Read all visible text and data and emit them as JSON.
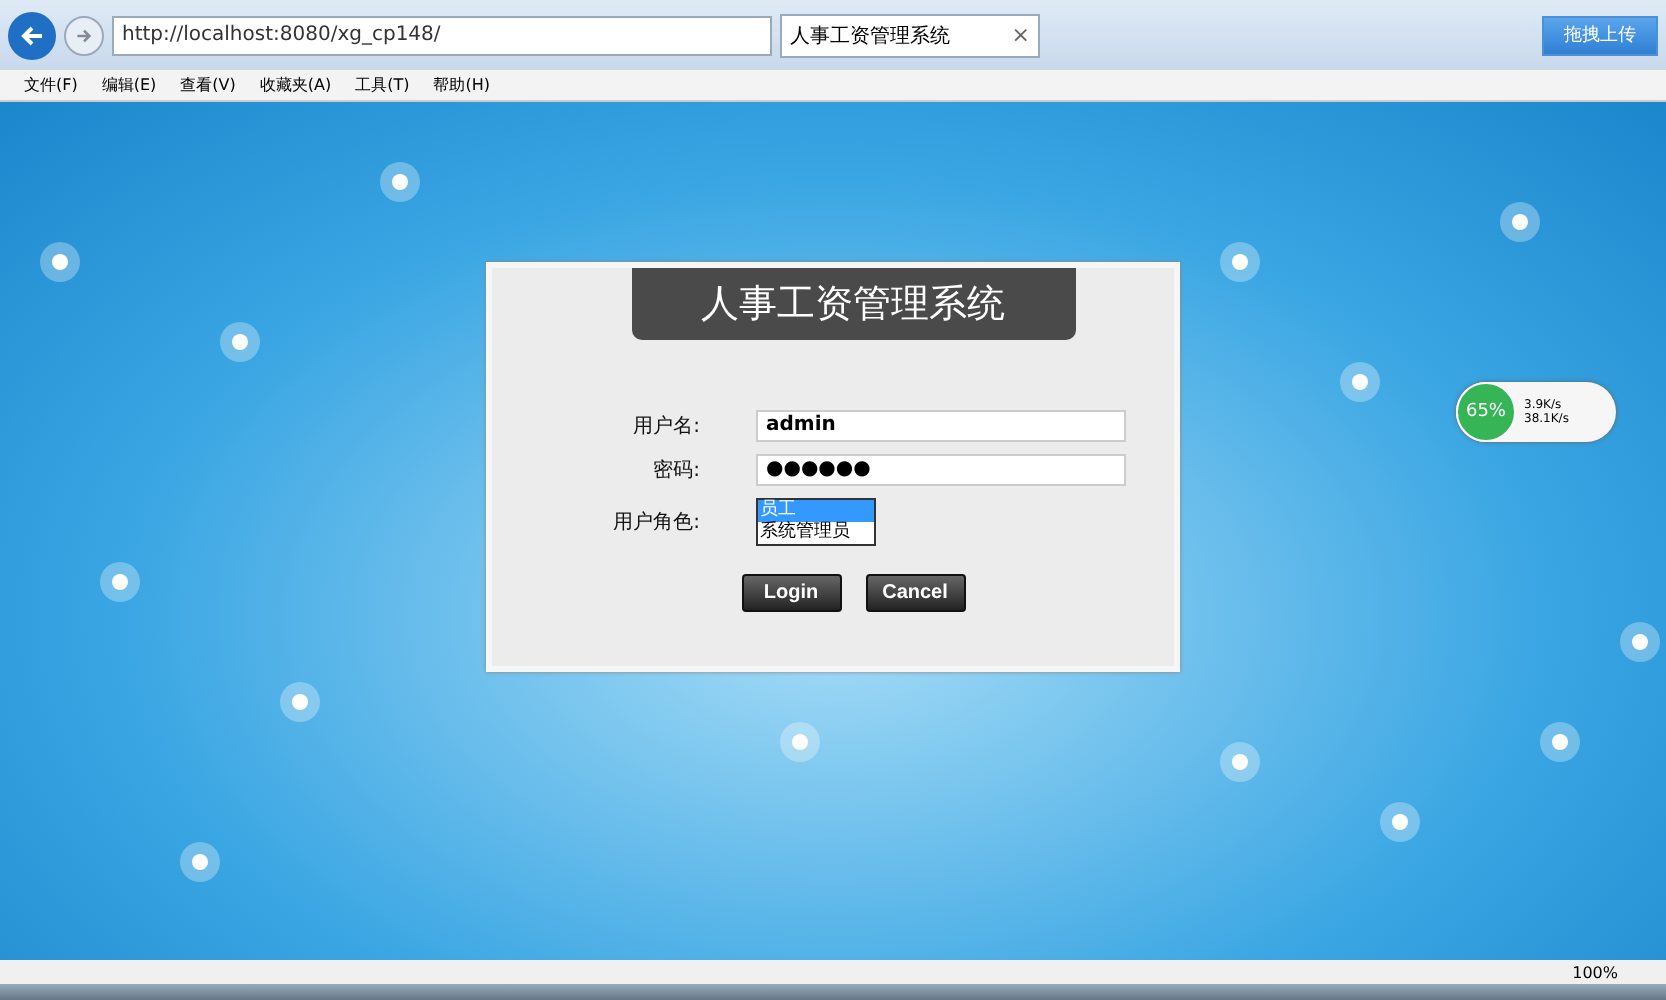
{
  "browser": {
    "address": "http://localhost:8080/xg_cp148/",
    "tab": {
      "title": "人事工资管理系统",
      "close": "×"
    },
    "upload_button": "拖拽上传"
  },
  "menu": [
    "文件(F)",
    "编辑(E)",
    "查看(V)",
    "收藏夹(A)",
    "工具(T)",
    "帮助(H)"
  ],
  "login": {
    "title": "人事工资管理系统",
    "fields": [
      {
        "label": "用户名:",
        "value": "admin"
      },
      {
        "label": "密码:",
        "value": "●●●●●●"
      }
    ],
    "role": {
      "label": "用户角色:",
      "options": [
        {
          "label": "员工",
          "selected": true
        },
        {
          "label": "系统管理员",
          "selected": false
        }
      ]
    },
    "buttons": [
      "Login",
      "Cancel"
    ]
  },
  "speed_widget": {
    "percent": "65%",
    "upload": "3.9K/s",
    "download": "38.1K/s"
  },
  "status_bar": {
    "zoom": "100%"
  }
}
